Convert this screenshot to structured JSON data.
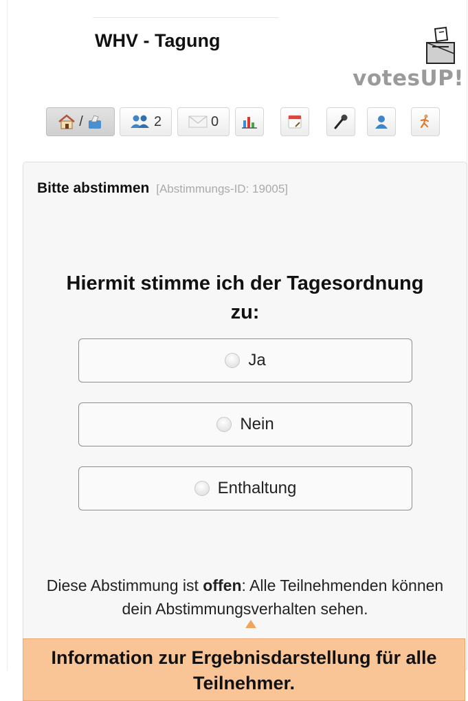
{
  "header": {
    "title": "WHV - Tagung",
    "logo_text": "votesUP!"
  },
  "toolbar": {
    "home_separator": "/",
    "participants_count": "2",
    "messages_count": "0",
    "icons": [
      "home-icon",
      "ballot-box-icon",
      "participants-icon",
      "mail-icon",
      "results-chart-icon",
      "calendar-icon",
      "microphone-icon",
      "user-icon",
      "exit-runner-icon"
    ]
  },
  "panel": {
    "heading": "Bitte abstimmen",
    "vote_id": "[Abstimmungs-ID: 19005]",
    "question": "Hiermit stimme ich der Tagesordnung zu:",
    "options": [
      {
        "label": "Ja"
      },
      {
        "label": "Nein"
      },
      {
        "label": "Enthaltung"
      }
    ],
    "notice_prefix": "Diese Abstimmung ist ",
    "notice_bold": "offen",
    "notice_suffix": ": Alle Teilnehmenden können dein Abstimmungsverhalten sehen."
  },
  "callout": {
    "text": "Information zur Ergebnisdarstellung für alle Teilnehmer."
  },
  "colors": {
    "callout_bg": "#fac596",
    "callout_arrow": "#f0a45c",
    "logo_gray": "#9a9a9a"
  }
}
